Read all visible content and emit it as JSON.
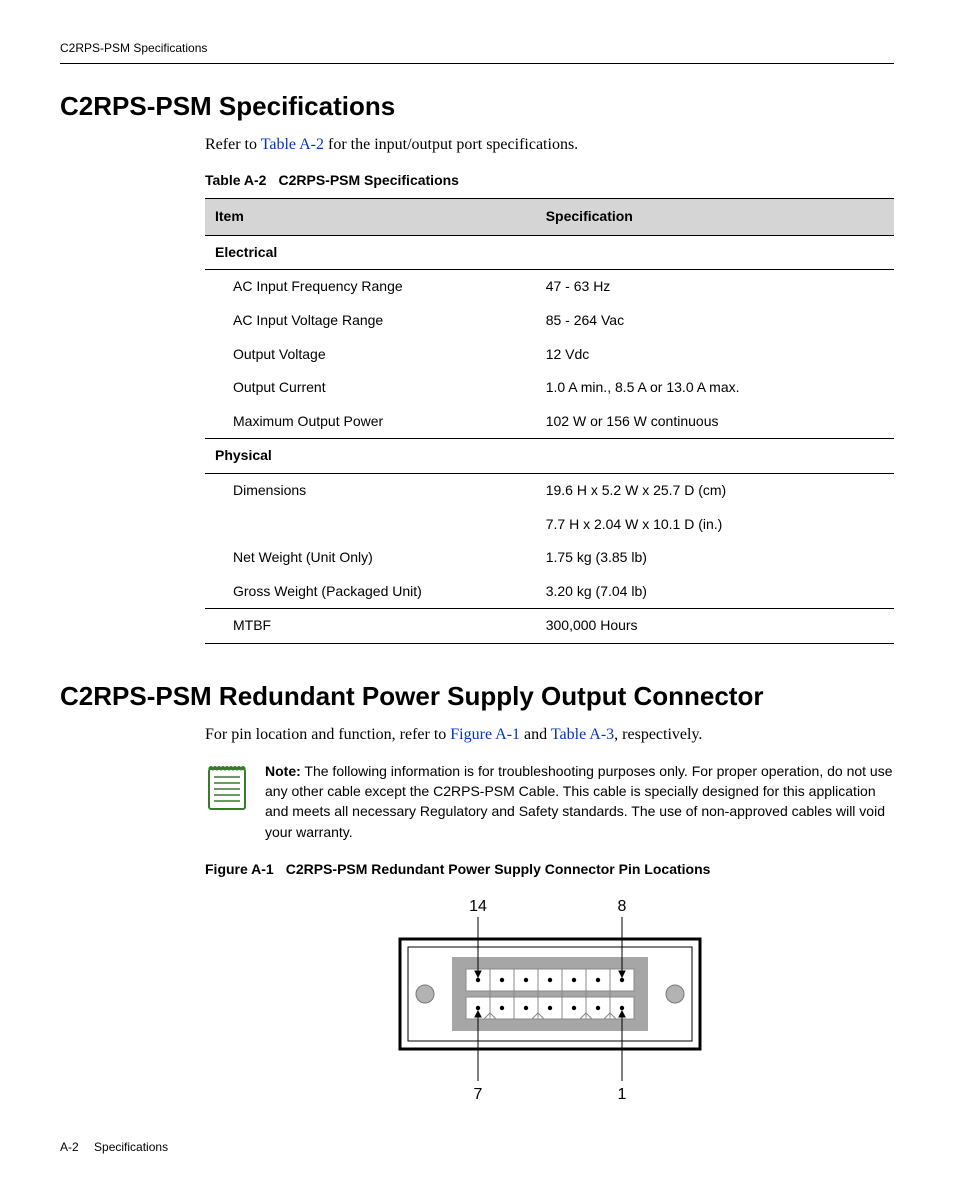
{
  "header": {
    "running_title": "C2RPS-PSM Specifications"
  },
  "section1": {
    "heading": "C2RPS-PSM Specifications",
    "intro_pre": "Refer to ",
    "intro_link": "Table A-2",
    "intro_post": " for the input/output port specifications.",
    "table_caption_num": "Table A-2",
    "table_caption_text": "C2RPS-PSM Specifications",
    "col1": "Item",
    "col2": "Specification",
    "group1": "Electrical",
    "rows1": [
      {
        "item": "AC Input Frequency Range",
        "spec": "47 - 63 Hz"
      },
      {
        "item": "AC Input Voltage Range",
        "spec": "85 - 264 Vac"
      },
      {
        "item": "Output Voltage",
        "spec": "12 Vdc"
      },
      {
        "item": "Output Current",
        "spec": "1.0 A min., 8.5 A or 13.0 A max."
      },
      {
        "item": "Maximum Output Power",
        "spec": "102 W or 156 W continuous"
      }
    ],
    "group2": "Physical",
    "rows2": [
      {
        "item": "Dimensions",
        "spec": "19.6 H x 5.2 W x 25.7 D (cm)"
      },
      {
        "item": "",
        "spec": "7.7 H x 2.04 W x 10.1 D (in.)"
      },
      {
        "item": "Net Weight (Unit Only)",
        "spec": "1.75 kg (3.85 lb)"
      },
      {
        "item": "Gross Weight (Packaged Unit)",
        "spec": "3.20 kg (7.04 lb)"
      }
    ],
    "rows3": [
      {
        "item": "MTBF",
        "spec": "300,000 Hours"
      }
    ]
  },
  "section2": {
    "heading": "C2RPS-PSM Redundant Power Supply Output Connector",
    "intro_pre": "For pin location and function, refer to ",
    "intro_link1": "Figure A-1",
    "intro_mid": " and ",
    "intro_link2": "Table A-3",
    "intro_post": ", respectively.",
    "note_label": "Note:",
    "note_text": " The following information is for troubleshooting purposes only. For proper operation, do not use any other cable except the C2RPS-PSM Cable. This cable is specially designed for this application and meets all necessary Regulatory and Safety standards. The use of non-approved cables will void your warranty.",
    "figure_caption_num": "Figure A-1",
    "figure_caption_text": "C2RPS-PSM Redundant Power Supply Connector Pin Locations",
    "pin_labels": {
      "tl": "14",
      "tr": "8",
      "bl": "7",
      "br": "1"
    }
  },
  "footer": {
    "page": "A-2",
    "section": "Specifications"
  }
}
